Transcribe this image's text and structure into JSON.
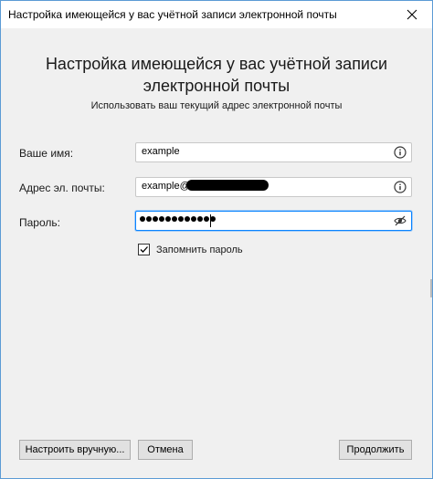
{
  "window": {
    "title": "Настройка имеющейся у вас учётной записи электронной почты"
  },
  "heading": {
    "line1": "Настройка имеющейся у вас учётной записи",
    "line2": "электронной почты",
    "subtitle": "Использовать ваш текущий адрес электронной почты"
  },
  "fields": {
    "name": {
      "label": "Ваше имя:",
      "value": "example",
      "icon": "info-icon"
    },
    "email": {
      "label": "Адрес эл. почты:",
      "value": "example@",
      "icon": "info-icon"
    },
    "password": {
      "label": "Пароль:",
      "masked_length": 12,
      "icon": "eye-slash-icon"
    }
  },
  "remember_password": {
    "label": "Запомнить пароль",
    "checked": true
  },
  "buttons": {
    "manual": "Настроить вручную...",
    "cancel": "Отмена",
    "continue": "Продолжить"
  },
  "colors": {
    "focus_border": "#0a84ff",
    "window_border": "#5b9bd5",
    "background": "#f0f0f0"
  }
}
